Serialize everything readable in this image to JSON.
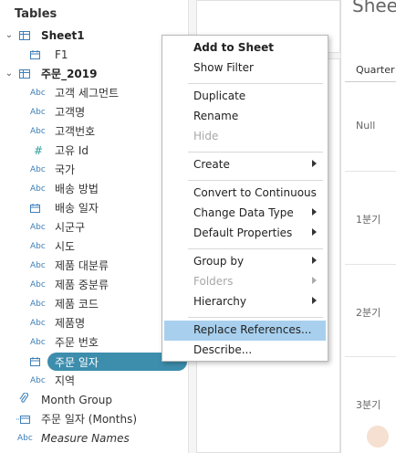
{
  "data_pane": {
    "title": "Tables",
    "datasources": [
      {
        "name": "Sheet1",
        "fields": [
          {
            "label": "F1",
            "type": "date"
          }
        ]
      },
      {
        "name": "주문_2019",
        "fields": [
          {
            "label": "고객 세그먼트",
            "type": "Abc"
          },
          {
            "label": "고객명",
            "type": "Abc"
          },
          {
            "label": "고객번호",
            "type": "Abc"
          },
          {
            "label": "고유 Id",
            "type": "#"
          },
          {
            "label": "국가",
            "type": "Abc"
          },
          {
            "label": "배송 방법",
            "type": "Abc"
          },
          {
            "label": "배송 일자",
            "type": "date"
          },
          {
            "label": "시군구",
            "type": "Abc"
          },
          {
            "label": "시도",
            "type": "Abc"
          },
          {
            "label": "제품 대분류",
            "type": "Abc"
          },
          {
            "label": "제품 중분류",
            "type": "Abc"
          },
          {
            "label": "제품 코드",
            "type": "Abc"
          },
          {
            "label": "제품명",
            "type": "Abc"
          },
          {
            "label": "주문 번호",
            "type": "Abc"
          },
          {
            "label": "주문 일자",
            "type": "date"
          },
          {
            "label": "지역",
            "type": "Abc"
          }
        ]
      }
    ],
    "extra_fields": [
      {
        "label": "Month Group",
        "type": "group"
      },
      {
        "label": "주문 일자 (Months)",
        "type": "date-custom"
      },
      {
        "label": "Measure Names",
        "type": "Abc"
      }
    ],
    "selected_field": "주문 일자"
  },
  "viz": {
    "sheet_title": "Sheet",
    "column_header": "Quarter",
    "rows": [
      "Null",
      "1분기",
      "2분기",
      "3분기"
    ]
  },
  "context_menu": {
    "items": [
      {
        "label": "Add to Sheet",
        "style": "bold"
      },
      {
        "label": "Show Filter"
      },
      {
        "label": "Duplicate"
      },
      {
        "label": "Rename"
      },
      {
        "label": "Hide",
        "disabled": true
      },
      {
        "label": "Create",
        "submenu": true
      },
      {
        "label": "Convert to Continuous"
      },
      {
        "label": "Change Data Type",
        "submenu": true
      },
      {
        "label": "Default Properties",
        "submenu": true
      },
      {
        "label": "Group by",
        "submenu": true
      },
      {
        "label": "Folders",
        "submenu": true,
        "disabled": true
      },
      {
        "label": "Hierarchy",
        "submenu": true
      },
      {
        "label": "Replace References...",
        "highlighted": true
      },
      {
        "label": "Describe..."
      }
    ]
  },
  "colors": {
    "selected_pill": "#3d8dad",
    "menu_highlight": "#a8d0ee",
    "dimension_icon": "#3d7fb8",
    "measure_icon": "#2b9d9c"
  }
}
